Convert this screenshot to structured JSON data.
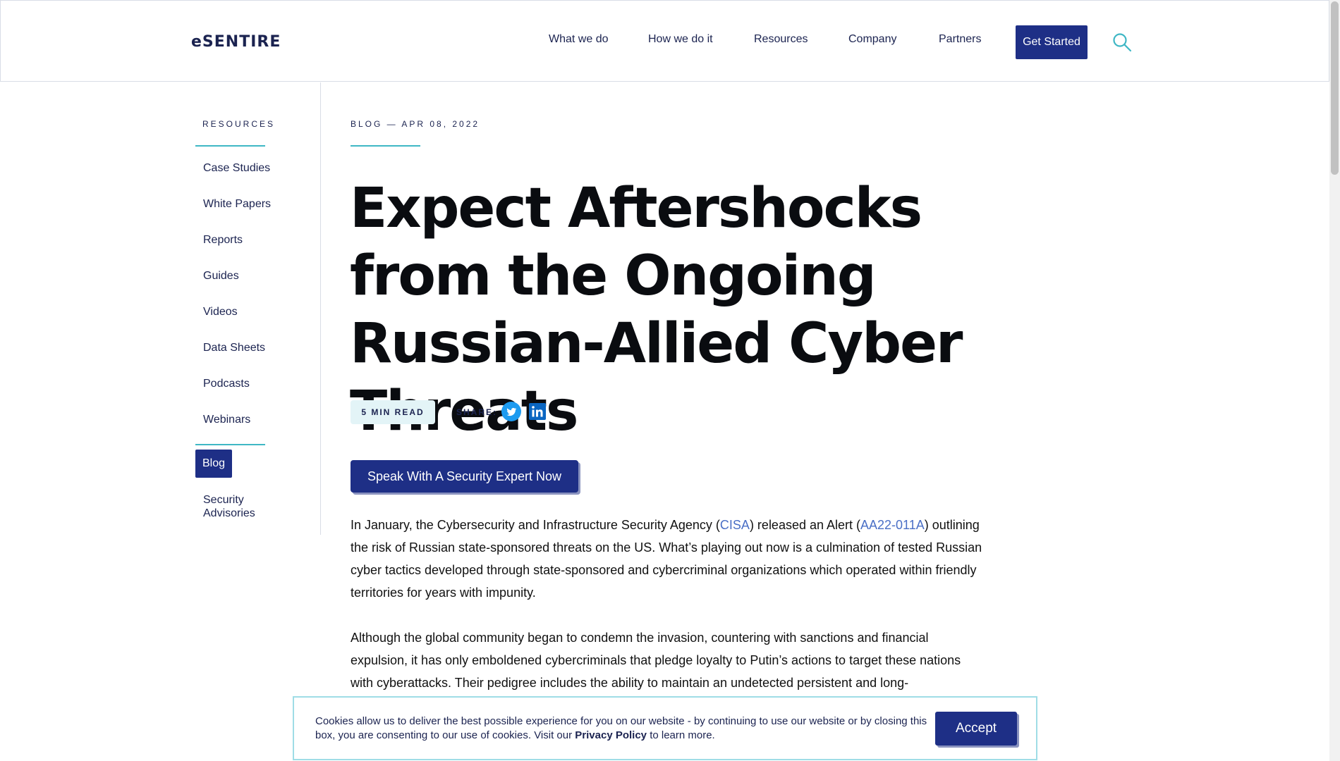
{
  "header": {
    "logo": "eSENTIRE",
    "nav": [
      "What we do",
      "How we do it",
      "Resources",
      "Company",
      "Partners"
    ],
    "cta": "Get Started",
    "search_icon": "search-icon"
  },
  "sidebar": {
    "heading": "RESOURCES",
    "items": [
      "Case Studies",
      "White Papers",
      "Reports",
      "Guides",
      "Videos",
      "Data Sheets",
      "Podcasts",
      "Webinars"
    ],
    "active": "Blog",
    "last_item": "Security Advisories"
  },
  "article": {
    "meta": "BLOG — APR 08, 2022",
    "title": "Expect Aftershocks from the Ongoing Russian-Allied Cyber Threats",
    "read_time": "5 MIN READ",
    "share_label": "SHARE:",
    "expert_button": "Speak With A Security Expert Now",
    "p1": {
      "a": "In January, the Cybersecurity and Infrastructure Security Agency (",
      "link1": "CISA",
      "b": ") released an Alert (",
      "link2": "AA22-011A",
      "c": ") outlining the risk of Russian state-sponsored threats on the US. What’s playing out now is a culmination of tested Russian cyber tactics developed through state-sponsored and cybercriminal organizations which operated within friendly territories for years with impunity."
    },
    "p2": "Although the global community began to condemn the invasion, countering with sanctions and financial expulsion, it has only emboldened cybercriminals that pledge loyalty to Putin’s actions to target these nations with cyberattacks. Their pedigree includes the ability to maintain an undetected persistent and long-"
  },
  "cookie": {
    "text": "Cookies allow us to deliver the best possible experience for you on our website - by continuing to use our website or by closing this box, you are consenting to our use of cookies. Visit our",
    "link": "Privacy Policy",
    "tail": "to learn more.",
    "accept": "Accept"
  },
  "colors": {
    "brand_navy": "#1e2f86",
    "text_navy": "#1b2350",
    "accent_teal": "#3fb7c5",
    "link_blue": "#4a6fc6",
    "twitter_blue": "#1d9bf0",
    "linkedin_blue": "#0a66c2"
  }
}
